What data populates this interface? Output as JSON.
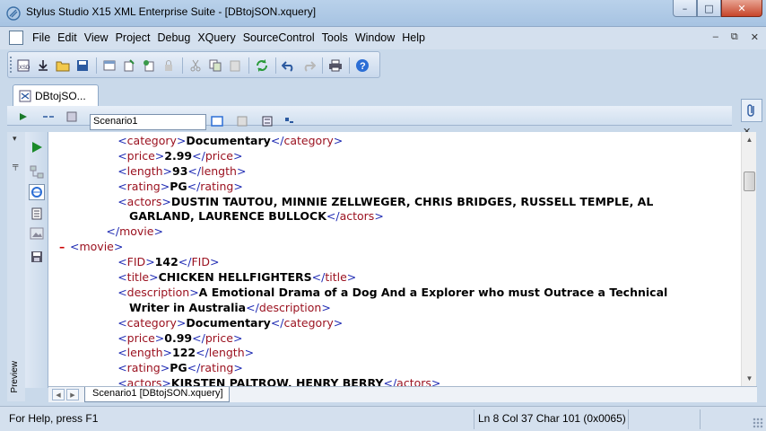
{
  "window": {
    "title": "Stylus Studio X15 XML Enterprise Suite - [DBtojSON.xquery]",
    "min_symbol": "–",
    "max_symbol": "□",
    "close_symbol": "✕"
  },
  "menu": {
    "items": [
      "File",
      "Edit",
      "View",
      "Project",
      "Debug",
      "XQuery",
      "SourceControl",
      "Tools",
      "Window",
      "Help"
    ],
    "right_controls": [
      "–",
      "⧉",
      "✕"
    ]
  },
  "doc_tab": {
    "label": "DBtojSO..."
  },
  "scenario": {
    "selected": "Scenario1"
  },
  "left_pane": {
    "label": "Preview"
  },
  "editor": {
    "lines": [
      {
        "indent": 4,
        "fold": "",
        "tag": "category",
        "value": "Documentary",
        "close": true
      },
      {
        "indent": 4,
        "fold": "",
        "tag": "price",
        "value": "2.99",
        "close": true
      },
      {
        "indent": 4,
        "fold": "",
        "tag": "length",
        "value": "93",
        "close": true
      },
      {
        "indent": 4,
        "fold": "",
        "tag": "rating",
        "value": "PG",
        "close": true
      },
      {
        "indent": 4,
        "fold": "",
        "tag": "actors",
        "value": "DUSTIN TAUTOU, MINNIE ZELLWEGER, CHRIS BRIDGES, RUSSELL TEMPLE, AL",
        "close": false
      },
      {
        "indent": 5,
        "fold": "",
        "tag": "",
        "value": "GARLAND, LAURENCE BULLOCK",
        "close_tag": "actors"
      },
      {
        "indent": 3,
        "fold": "",
        "tag": "",
        "value": "",
        "close_tag": "movie"
      },
      {
        "indent": 0,
        "fold": "–",
        "tag": "movie",
        "value": "",
        "close": false
      },
      {
        "indent": 4,
        "fold": "",
        "tag": "FID",
        "value": "142",
        "close": true
      },
      {
        "indent": 4,
        "fold": "",
        "tag": "title",
        "value": "CHICKEN HELLFIGHTERS",
        "close": true
      },
      {
        "indent": 4,
        "fold": "",
        "tag": "description",
        "value": "A Emotional Drama of a Dog And a Explorer who must Outrace a Technical",
        "close": false
      },
      {
        "indent": 5,
        "fold": "",
        "tag": "",
        "value": "Writer in Australia",
        "close_tag": "description"
      },
      {
        "indent": 4,
        "fold": "",
        "tag": "category",
        "value": "Documentary",
        "close": true
      },
      {
        "indent": 4,
        "fold": "",
        "tag": "price",
        "value": "0.99",
        "close": true
      },
      {
        "indent": 4,
        "fold": "",
        "tag": "length",
        "value": "122",
        "close": true
      },
      {
        "indent": 4,
        "fold": "",
        "tag": "rating",
        "value": "PG",
        "close": true
      },
      {
        "indent": 4,
        "fold": "",
        "tag": "actors",
        "value": "KIRSTEN PALTROW, HENRY BERRY",
        "close": true
      }
    ]
  },
  "bottom_tab": {
    "label": "Scenario1 [DBtojSON.xquery]"
  },
  "status": {
    "left": "For Help, press F1",
    "right": "Ln 8 Col 37  Char 101 (0x0065)"
  },
  "colors": {
    "tag": "#9b1220",
    "bracket": "#1f2bb3",
    "chrome": "#c9d9ea"
  }
}
